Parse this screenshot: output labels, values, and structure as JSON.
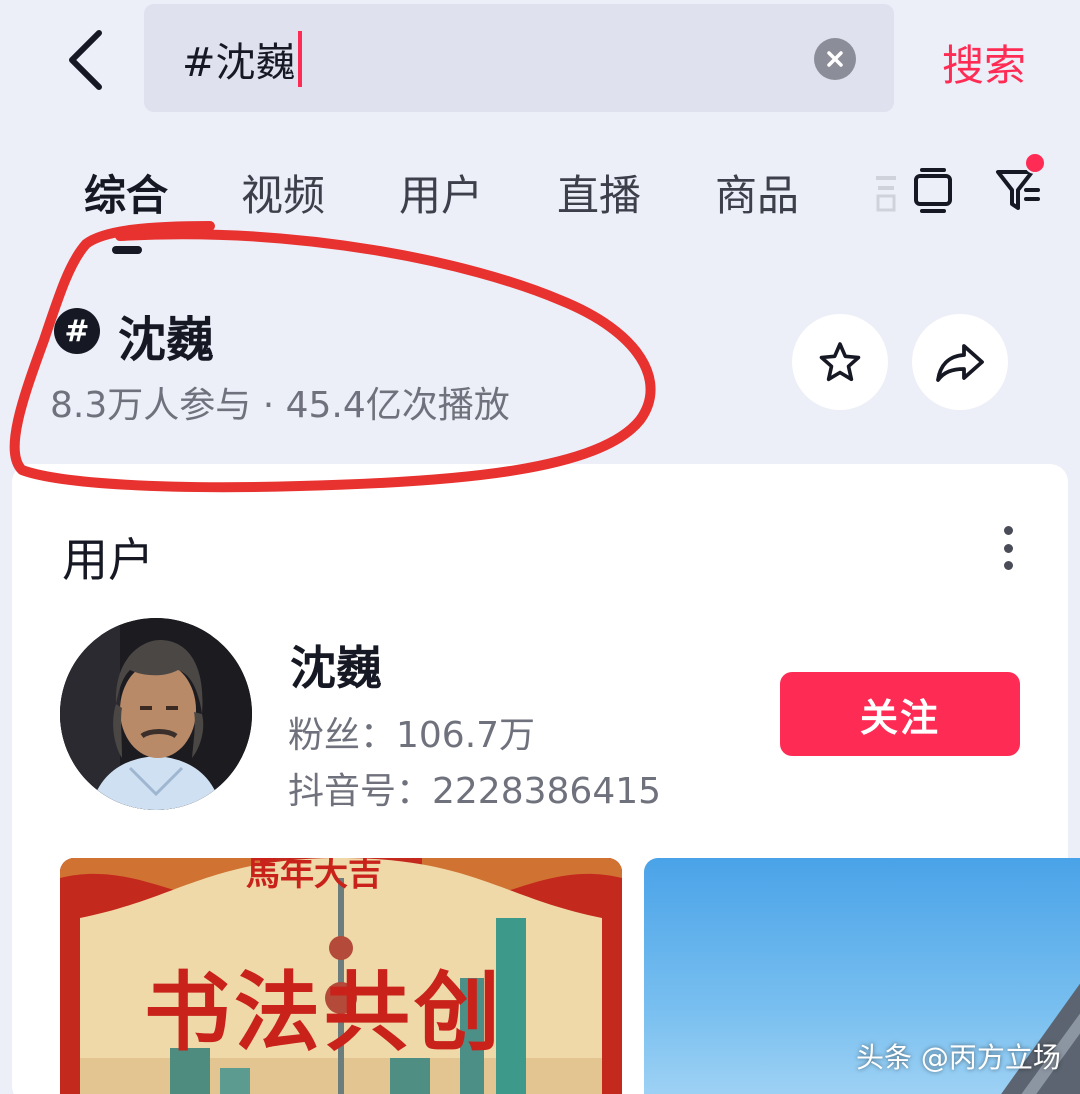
{
  "search": {
    "query": "#沈巍",
    "submit_label": "搜索"
  },
  "tabs": [
    {
      "label": "综合",
      "active": true
    },
    {
      "label": "视频",
      "active": false
    },
    {
      "label": "用户",
      "active": false
    },
    {
      "label": "直播",
      "active": false
    },
    {
      "label": "商品",
      "active": false
    }
  ],
  "topic": {
    "icon": "#",
    "title": "沈巍",
    "stats": "8.3万人参与 · 45.4亿次播放"
  },
  "users_section": {
    "title": "用户",
    "user": {
      "name": "沈巍",
      "fans": "粉丝：106.7万",
      "douyin_id": "抖音号：2228386415",
      "follow_label": "关注"
    }
  },
  "thumbnails": {
    "first_title": "书法共创"
  },
  "watermark": "头条 @丙方立场",
  "colors": {
    "accent": "#fe2c55",
    "background": "#eceef8",
    "annotation": "#e8322f"
  },
  "icons": [
    "back-arrow-icon",
    "clear-icon",
    "layout-icon",
    "filter-icon",
    "hashtag-icon",
    "star-icon",
    "share-icon",
    "more-vertical-icon"
  ]
}
